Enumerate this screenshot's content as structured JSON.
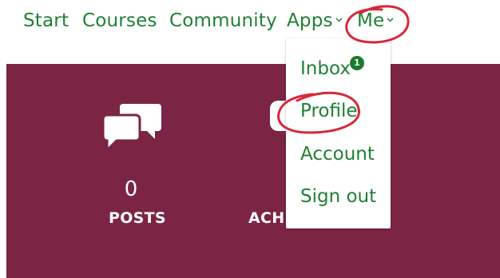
{
  "nav": {
    "items": [
      {
        "label": "Start"
      },
      {
        "label": "Courses"
      },
      {
        "label": "Community"
      },
      {
        "label": "Apps",
        "has_chevron": true
      },
      {
        "label": "Me",
        "has_chevron": true
      }
    ]
  },
  "dropdown": {
    "items": [
      {
        "label": "Inbox",
        "badge": "1"
      },
      {
        "label": "Profile"
      },
      {
        "label": "Account"
      },
      {
        "label": "Sign out"
      }
    ]
  },
  "stats": {
    "posts": {
      "count": "0",
      "label": "POSTS",
      "icon": "chat-bubbles-icon"
    },
    "achievements": {
      "label": "ACHI"
    }
  },
  "colors": {
    "link_green": "#1e8035",
    "band_maroon": "#7c2444",
    "badge_green": "#1a7a2e",
    "annotation_red": "#d9263a"
  }
}
